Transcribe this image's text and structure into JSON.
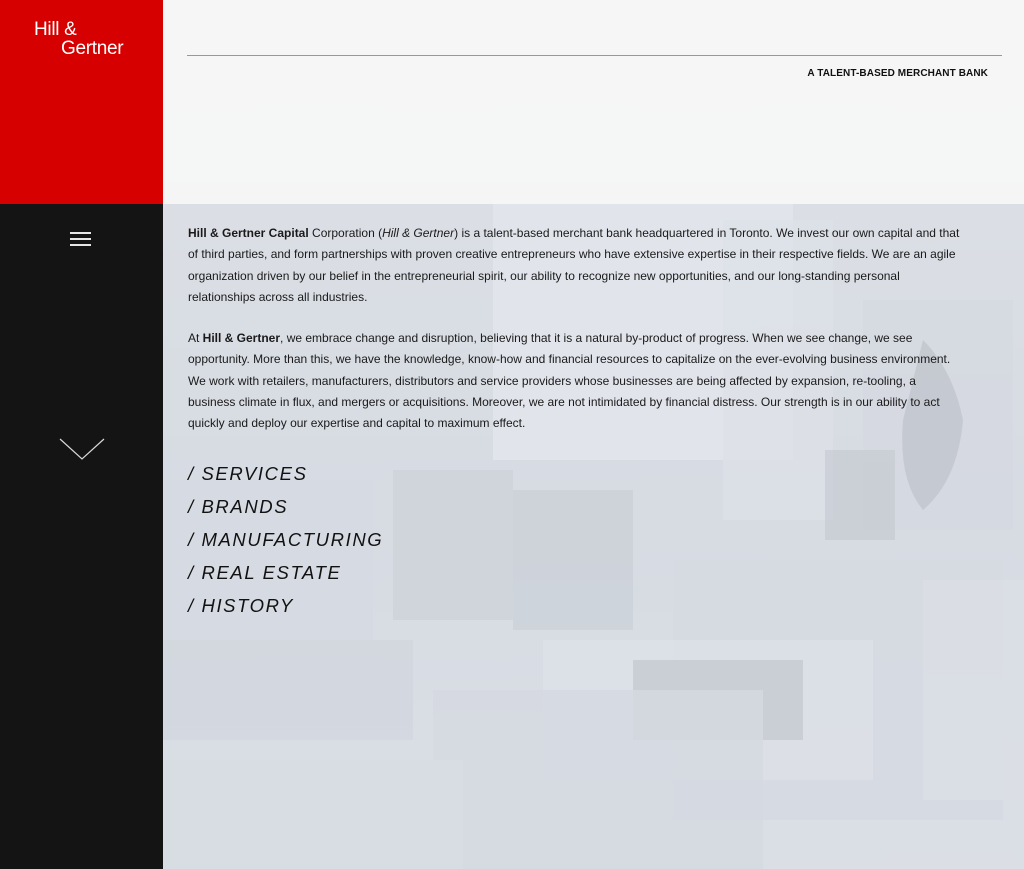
{
  "brand": {
    "logo_line1": "Hill &",
    "logo_line2": "Gertner",
    "tagline": "A TALENT-BASED MERCHANT BANK",
    "accent_color": "#d70000"
  },
  "sidebar": {
    "menu_icon": "hamburger-menu-icon",
    "scroll_icon": "chevron-down-icon"
  },
  "intro": {
    "p1_bold": "Hill & Gertner Capital",
    "p1_a": " Corporation (",
    "p1_italic": "Hill & Gertner",
    "p1_b": ") is a talent-based merchant bank headquartered in Toronto. We invest our own capital and that of third parties, and form partnerships with proven creative entrepreneurs who have extensive expertise in their respective fields. We are an agile organization driven by our belief in the entrepreneurial spirit, our ability to recognize new opportunities, and our long-standing personal relationships across all industries.",
    "p2_a": "At ",
    "p2_bold": "Hill & Gertner",
    "p2_b": ", we embrace change and disruption, believing that it is a natural by-product of progress. When we see change, we see opportunity. More than this, we have the knowledge, know-how and financial resources to capitalize on the ever-evolving business environment. We work with retailers, manufacturers, distributors and service providers whose businesses are being affected by expansion, re-tooling, a business climate in flux, and mergers or acquisitions. Moreover, we are not intimidated by financial distress. Our strength is in our ability to act quickly and deploy our expertise and capital to maximum effect."
  },
  "nav": {
    "items": [
      {
        "label": "/ SERVICES"
      },
      {
        "label": "/ BRANDS"
      },
      {
        "label": "/ MANUFACTURING"
      },
      {
        "label": "/ REAL ESTATE"
      },
      {
        "label": "/ HISTORY"
      }
    ]
  }
}
